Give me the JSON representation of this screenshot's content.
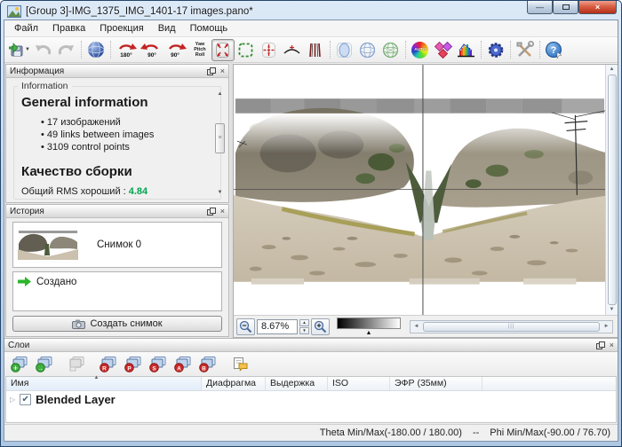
{
  "window": {
    "title": "[Group 3]-IMG_1375_IMG_1401-17 images.pano*"
  },
  "menu": {
    "items": [
      "Файл",
      "Правка",
      "Проекция",
      "Вид",
      "Помощь"
    ]
  },
  "toolbar": {
    "rotate180": "180°",
    "rotate90ccw": "90°",
    "rotate90cw": "90°",
    "ypr": [
      "Yaw",
      "Pitch",
      "Roll"
    ],
    "auto": "AUTO"
  },
  "info_panel": {
    "title": "Информация",
    "group_label": "Information",
    "heading": "General information",
    "bullets": [
      "17 изображений",
      "49 links between images",
      "3109 control points"
    ],
    "quality_heading": "Качество сборки",
    "rms_label": "Общий RMS хороший :",
    "rms_value": "4.84"
  },
  "history_panel": {
    "title": "История",
    "snapshot_label": "Снимок 0",
    "event_label": "Создано",
    "create_button": "Создать снимок"
  },
  "preview": {
    "zoom_value": "8.67%"
  },
  "layers_panel": {
    "title": "Слои",
    "badges": [
      "+",
      "→",
      "R",
      "P",
      "S",
      "A",
      "B"
    ],
    "columns": [
      "Имя",
      "Диафрагма",
      "Выдержка",
      "ISO",
      "ЭФР (35мм)"
    ],
    "row_name": "Blended Layer"
  },
  "status_bar": {
    "theta": "Theta Min/Max(-180.00 / 180.00)",
    "sep": "--",
    "phi": "Phi Min/Max(-90.00 / 76.70)"
  },
  "colors": {
    "rms_green": "#00a651",
    "accent_red": "#c22424"
  }
}
